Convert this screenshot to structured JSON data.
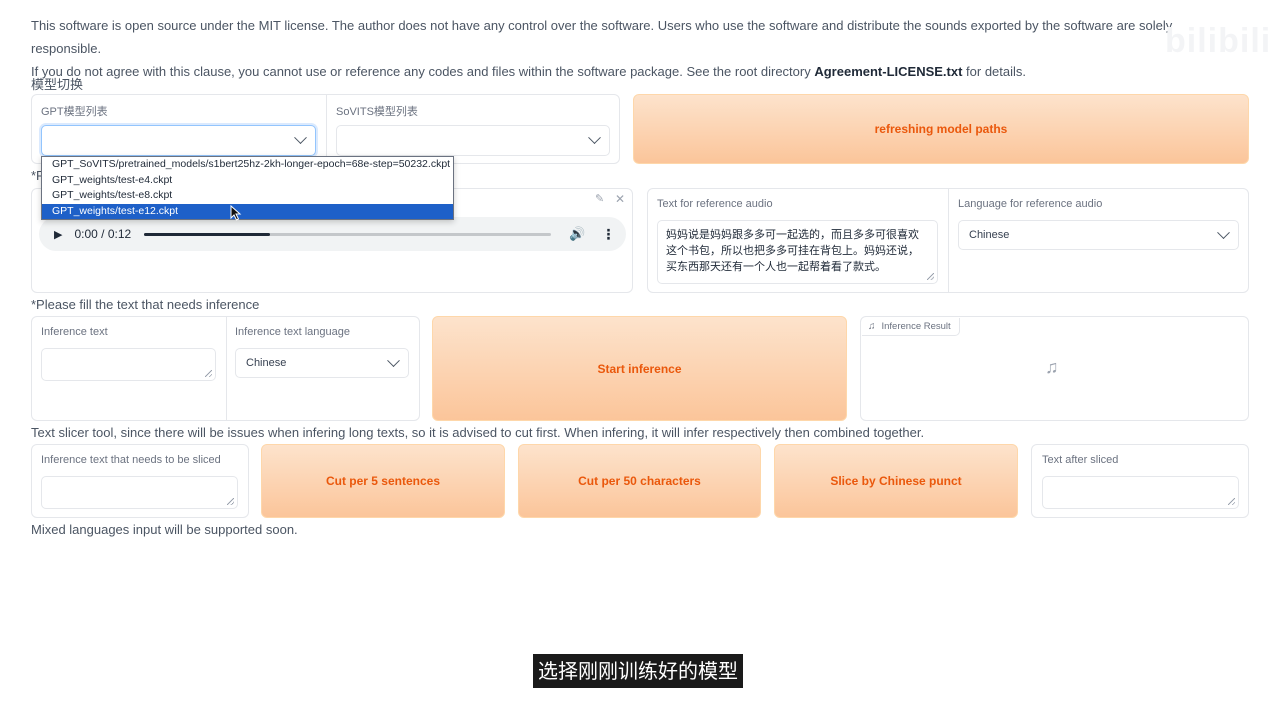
{
  "notice": {
    "line1": "This software is open source under the MIT license. The author does not have any control over the software. Users who use the software and distribute the sounds exported by the software are solely responsible.",
    "line2_prefix": "If you do not agree with this clause, you cannot use or reference any codes and files within the software package. See the root directory ",
    "line2_bold": "Agreement-LICENSE.txt",
    "line2_suffix": " for details."
  },
  "watermark": "bilibili",
  "model_switch": {
    "label": "模型切换",
    "gpt_label": "GPT模型列表",
    "gpt_value": "",
    "sovits_label": "SoVITS模型列表",
    "sovits_value": "",
    "refresh_button": "refreshing model paths",
    "gpt_options": [
      "GPT_SoVITS/pretrained_models/s1bert25hz-2kh-longer-epoch=68e-step=50232.ckpt",
      "GPT_weights/test-e4.ckpt",
      "GPT_weights/test-e8.ckpt",
      "GPT_weights/test-e12.ckpt"
    ],
    "selected_option_index": 3
  },
  "reference": {
    "section_label_partial": "*F",
    "audio_time": "0:00 / 0:12",
    "audio_progress": 0.31,
    "text_label": "Text for reference audio",
    "text_value": "妈妈说是妈妈跟多多可一起选的，而且多多可很喜欢这个书包，所以也把多多可挂在背包上。妈妈还说，买东西那天还有一个人也一起帮着看了款式。",
    "lang_label": "Language for reference audio",
    "lang_value": "Chinese"
  },
  "inference": {
    "section_label": "*Please fill the text that needs inference",
    "text_label": "Inference text",
    "text_value": "",
    "lang_label": "Inference text language",
    "lang_value": "Chinese",
    "start_button": "Start inference",
    "result_label": "Inference Result"
  },
  "slicer": {
    "section_label": "Text slicer tool, since there will be issues when infering long texts, so it is advised to cut first. When infering, it will infer respectively then combined together.",
    "input_label": "Inference text that needs to be sliced",
    "input_value": "",
    "btn_cut5": "Cut per 5 sentences",
    "btn_cut50": "Cut per 50 characters",
    "btn_punct": "Slice by Chinese punct",
    "output_label": "Text after sliced",
    "output_value": ""
  },
  "footer_note": "Mixed languages input will be supported soon.",
  "caption": "选择刚刚训练好的模型"
}
